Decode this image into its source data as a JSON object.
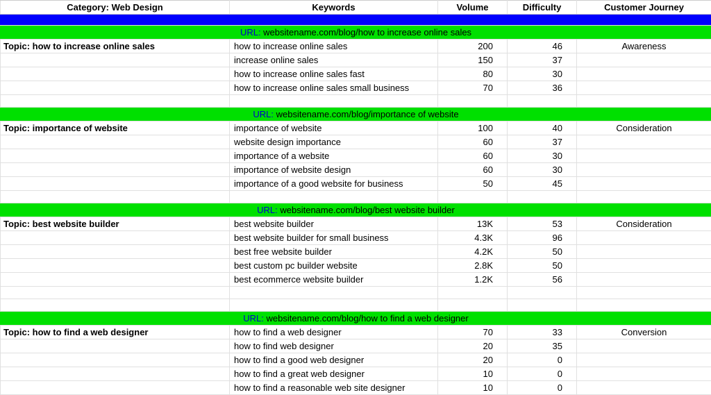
{
  "headers": {
    "category_label": "Category:",
    "category_value": "Web Design",
    "keywords": "Keywords",
    "volume": "Volume",
    "difficulty": "Difficulty",
    "customer_journey": "Customer Journey"
  },
  "url_label": "URL:",
  "topic_label": "Topic:",
  "groups": [
    {
      "url": "websitename.com/blog/how to increase online sales",
      "topic": "how to increase online sales",
      "journey": "Awareness",
      "rows": [
        {
          "kw": "how to increase online sales",
          "vol": "200",
          "dif": "46"
        },
        {
          "kw": "increase online sales",
          "vol": "150",
          "dif": "37"
        },
        {
          "kw": "how to increase online sales fast",
          "vol": "80",
          "dif": "30"
        },
        {
          "kw": "how to increase online sales small business",
          "vol": "70",
          "dif": "36"
        }
      ],
      "trailing_blank_rows": 1
    },
    {
      "url": "websitename.com/blog/importance of website",
      "topic": "importance of website",
      "journey": "Consideration",
      "rows": [
        {
          "kw": "importance of website",
          "vol": "100",
          "dif": "40"
        },
        {
          "kw": "website design importance",
          "vol": "60",
          "dif": "37"
        },
        {
          "kw": "importance of a website",
          "vol": "60",
          "dif": "30"
        },
        {
          "kw": "importance of website design",
          "vol": "60",
          "dif": "30"
        },
        {
          "kw": "importance of a good website for business",
          "vol": "50",
          "dif": "45"
        }
      ],
      "trailing_blank_rows": 1
    },
    {
      "url": "websitename.com/blog/best website builder",
      "topic": "best website builder",
      "journey": "Consideration",
      "rows": [
        {
          "kw": "best website builder",
          "vol": "13K",
          "dif": "53"
        },
        {
          "kw": "best website builder for small business",
          "vol": "4.3K",
          "dif": "96"
        },
        {
          "kw": "best free website builder",
          "vol": "4.2K",
          "dif": "50"
        },
        {
          "kw": "best custom pc builder website",
          "vol": "2.8K",
          "dif": "50"
        },
        {
          "kw": "best ecommerce website builder",
          "vol": "1.2K",
          "dif": "56"
        }
      ],
      "trailing_blank_rows": 2
    },
    {
      "url": "websitename.com/blog/how to find a web designer",
      "topic": "how to find a web designer",
      "journey": "Conversion",
      "rows": [
        {
          "kw": "how to find a web designer",
          "vol": "70",
          "dif": "33"
        },
        {
          "kw": "how to find web designer",
          "vol": "20",
          "dif": "35"
        },
        {
          "kw": "how to find a good web designer",
          "vol": "20",
          "dif": "0"
        },
        {
          "kw": "how to find a great web designer",
          "vol": "10",
          "dif": "0"
        },
        {
          "kw": "how to find a reasonable web site designer",
          "vol": "10",
          "dif": "0"
        }
      ],
      "trailing_blank_rows": 0
    }
  ]
}
